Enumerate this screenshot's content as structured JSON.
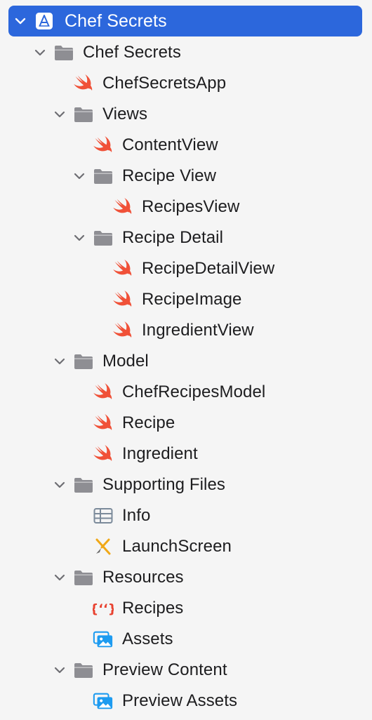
{
  "navigator": {
    "project": {
      "label": "Chef Secrets",
      "icon": "xcode-project-icon",
      "expanded": true
    },
    "items": [
      {
        "label": "Chef Secrets",
        "icon": "folder-icon",
        "depth": 1,
        "expanded": true
      },
      {
        "label": "ChefSecretsApp",
        "icon": "swift-icon",
        "depth": 2
      },
      {
        "label": "Views",
        "icon": "folder-icon",
        "depth": 2,
        "expanded": true
      },
      {
        "label": "ContentView",
        "icon": "swift-icon",
        "depth": 3
      },
      {
        "label": "Recipe View",
        "icon": "folder-icon",
        "depth": 3,
        "expanded": true
      },
      {
        "label": "RecipesView",
        "icon": "swift-icon",
        "depth": 4
      },
      {
        "label": "Recipe Detail",
        "icon": "folder-icon",
        "depth": 3,
        "expanded": true
      },
      {
        "label": "RecipeDetailView",
        "icon": "swift-icon",
        "depth": 4
      },
      {
        "label": "RecipeImage",
        "icon": "swift-icon",
        "depth": 4
      },
      {
        "label": "IngredientView",
        "icon": "swift-icon",
        "depth": 4
      },
      {
        "label": "Model",
        "icon": "folder-icon",
        "depth": 2,
        "expanded": true
      },
      {
        "label": "ChefRecipesModel",
        "icon": "swift-icon",
        "depth": 3
      },
      {
        "label": "Recipe",
        "icon": "swift-icon",
        "depth": 3
      },
      {
        "label": "Ingredient",
        "icon": "swift-icon",
        "depth": 3
      },
      {
        "label": "Supporting Files",
        "icon": "folder-icon",
        "depth": 2,
        "expanded": true
      },
      {
        "label": "Info",
        "icon": "plist-table-icon",
        "depth": 3
      },
      {
        "label": "LaunchScreen",
        "icon": "storyboard-icon",
        "depth": 3
      },
      {
        "label": "Resources",
        "icon": "folder-icon",
        "depth": 2,
        "expanded": true
      },
      {
        "label": "Recipes",
        "icon": "json-icon",
        "depth": 3
      },
      {
        "label": "Assets",
        "icon": "asset-catalog-icon",
        "depth": 3
      },
      {
        "label": "Preview Content",
        "icon": "folder-icon",
        "depth": 2,
        "expanded": true
      },
      {
        "label": "Preview Assets",
        "icon": "asset-catalog-icon",
        "depth": 3
      }
    ]
  },
  "colors": {
    "selection": "#2c67dc",
    "swift": "#f05138",
    "folder": "#8e8e93",
    "chevron": "#6e6e73",
    "json": "#e8412f",
    "asset": "#1d9bf0",
    "storyboard": "#f0a818"
  }
}
